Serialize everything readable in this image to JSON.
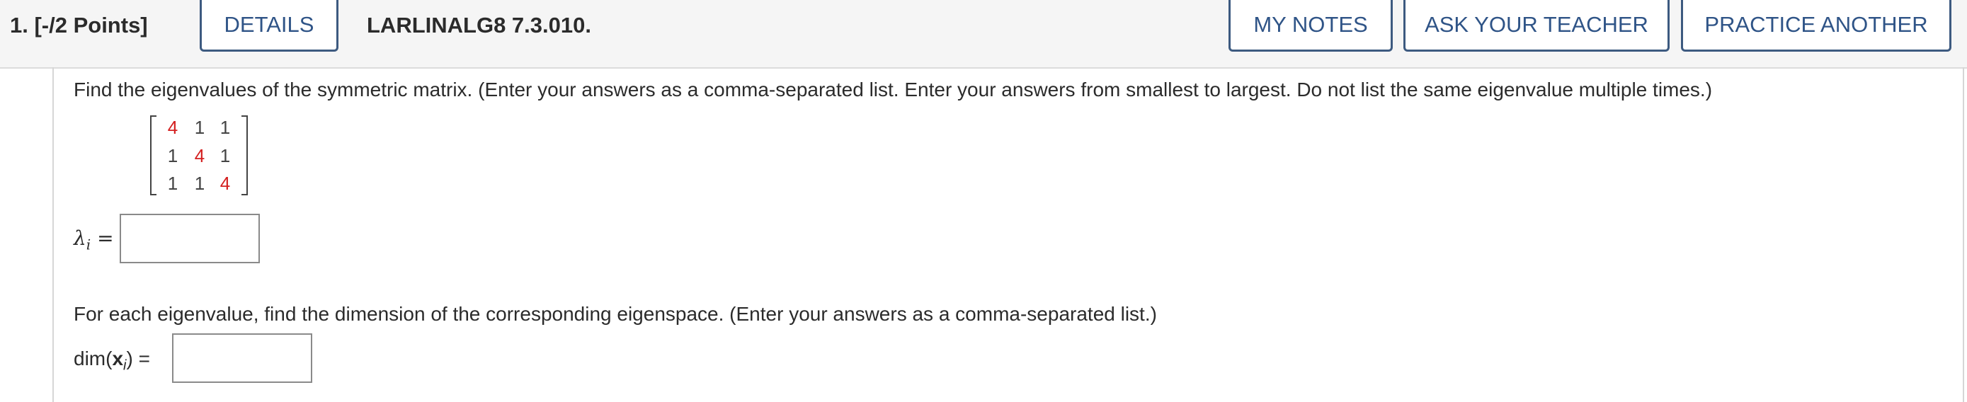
{
  "header": {
    "question_label": "1. [-/2 Points]",
    "details_label": "DETAILS",
    "problem_code": "LARLINALG8 7.3.010.",
    "my_notes_label": "MY NOTES",
    "ask_teacher_label": "ASK YOUR TEACHER",
    "practice_another_label": "PRACTICE ANOTHER"
  },
  "question": {
    "instruction_1": "Find the eigenvalues of the symmetric matrix. (Enter your answers as a comma-separated list. Enter your answers from smallest to largest. Do not list the same eigenvalue multiple times.)",
    "matrix": [
      [
        "4",
        "1",
        "1"
      ],
      [
        "1",
        "4",
        "1"
      ],
      [
        "1",
        "1",
        "4"
      ]
    ],
    "eigen_label_symbol": "λ",
    "eigen_label_subscript": "i",
    "eigen_label_eq": "=",
    "eigenvalues_value": "",
    "instruction_2": "For each eigenvalue, find the dimension of the corresponding eigenspace. (Enter your answers as a comma-separated list.)",
    "dim_label_prefix": "dim(",
    "dim_label_var": "x",
    "dim_label_subscript": "i",
    "dim_label_suffix": ")",
    "dim_label_eq": "=",
    "dimension_value": ""
  },
  "colors": {
    "accent_border": "#3d5a80",
    "button_text": "#2f5487",
    "diagonal_red": "#d42020",
    "header_bg": "#f5f5f5"
  }
}
